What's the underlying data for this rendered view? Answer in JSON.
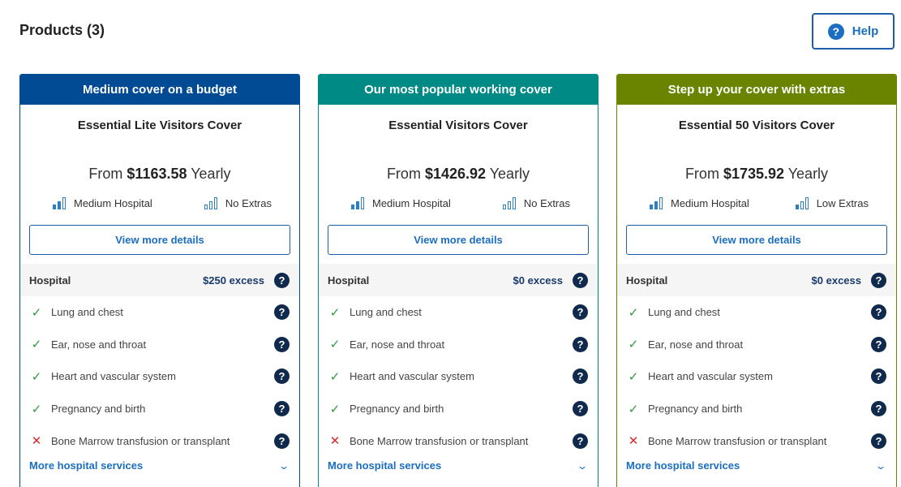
{
  "page": {
    "title": "Products (3)"
  },
  "help": {
    "label": "Help",
    "icon": "question-circle-icon"
  },
  "colors": {
    "card0": "#004b93",
    "card1": "#008a86",
    "card2": "#6a8400",
    "link": "#1c6ec0",
    "check": "#2e9c3a",
    "cross": "#d62828"
  },
  "cards": [
    {
      "header": "Medium cover on a budget",
      "name": "Essential Lite Visitors Cover",
      "price_prefix": "From ",
      "price": "$1163.58",
      "price_suffix": " Yearly",
      "hospital_level": "Medium Hospital",
      "extras_level": "No Extras",
      "details_label": "View more details",
      "hospital_label": "Hospital",
      "excess": "$250 excess",
      "services": [
        {
          "label": "Lung and chest",
          "covered": true
        },
        {
          "label": "Ear, nose and throat",
          "covered": true
        },
        {
          "label": "Heart and vascular system",
          "covered": true
        },
        {
          "label": "Pregnancy and birth",
          "covered": true
        },
        {
          "label": "Bone Marrow transfusion or transplant",
          "covered": false
        }
      ],
      "more_label": "More hospital services"
    },
    {
      "header": "Our most popular working cover",
      "name": "Essential Visitors Cover",
      "price_prefix": "From ",
      "price": "$1426.92",
      "price_suffix": " Yearly",
      "hospital_level": "Medium Hospital",
      "extras_level": "No Extras",
      "details_label": "View more details",
      "hospital_label": "Hospital",
      "excess": "$0 excess",
      "services": [
        {
          "label": "Lung and chest",
          "covered": true
        },
        {
          "label": "Ear, nose and throat",
          "covered": true
        },
        {
          "label": "Heart and vascular system",
          "covered": true
        },
        {
          "label": "Pregnancy and birth",
          "covered": true
        },
        {
          "label": "Bone Marrow transfusion or transplant",
          "covered": false
        }
      ],
      "more_label": "More hospital services"
    },
    {
      "header": "Step up your cover with extras",
      "name": "Essential 50 Visitors Cover",
      "price_prefix": "From ",
      "price": "$1735.92",
      "price_suffix": " Yearly",
      "hospital_level": "Medium Hospital",
      "extras_level": "Low Extras",
      "details_label": "View more details",
      "hospital_label": "Hospital",
      "excess": "$0 excess",
      "services": [
        {
          "label": "Lung and chest",
          "covered": true
        },
        {
          "label": "Ear, nose and throat",
          "covered": true
        },
        {
          "label": "Heart and vascular system",
          "covered": true
        },
        {
          "label": "Pregnancy and birth",
          "covered": true
        },
        {
          "label": "Bone Marrow transfusion or transplant",
          "covered": false
        }
      ],
      "more_label": "More hospital services"
    }
  ]
}
